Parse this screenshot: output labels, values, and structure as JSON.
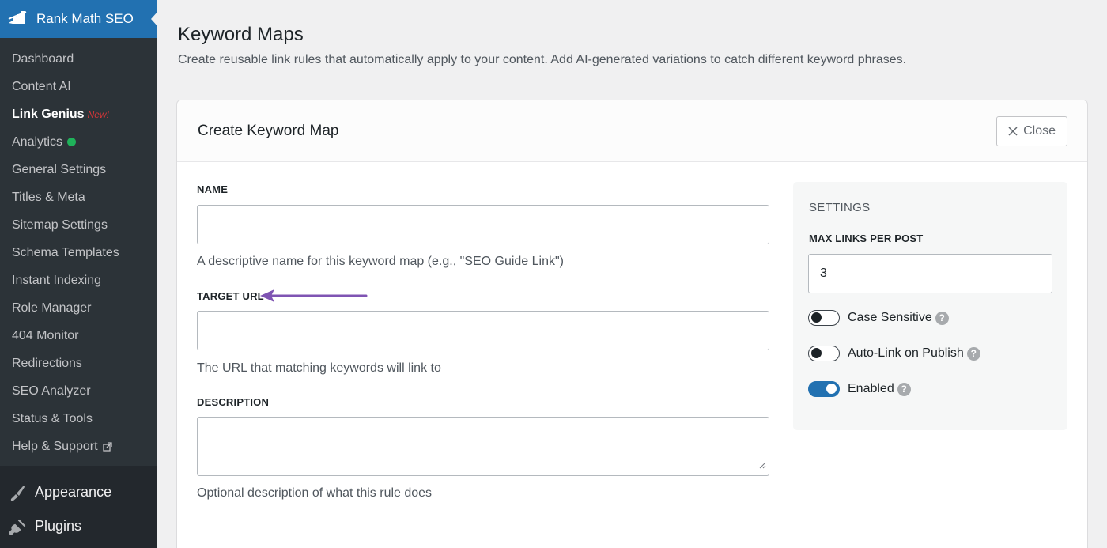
{
  "sidebar": {
    "brand": "Rank Math SEO",
    "items": [
      {
        "label": "Dashboard"
      },
      {
        "label": "Content AI"
      },
      {
        "label": "Link Genius",
        "badge": "New!"
      },
      {
        "label": "Analytics"
      },
      {
        "label": "General Settings"
      },
      {
        "label": "Titles & Meta"
      },
      {
        "label": "Sitemap Settings"
      },
      {
        "label": "Schema Templates"
      },
      {
        "label": "Instant Indexing"
      },
      {
        "label": "Role Manager"
      },
      {
        "label": "404 Monitor"
      },
      {
        "label": "Redirections"
      },
      {
        "label": "SEO Analyzer"
      },
      {
        "label": "Status & Tools"
      },
      {
        "label": "Help & Support"
      }
    ],
    "main": [
      {
        "label": "Appearance",
        "icon": "paintbrush-icon"
      },
      {
        "label": "Plugins",
        "icon": "plugin-icon"
      }
    ]
  },
  "page": {
    "title": "Keyword Maps",
    "description": "Create reusable link rules that automatically apply to your content. Add AI-generated variations to catch different keyword phrases."
  },
  "card": {
    "title": "Create Keyword Map",
    "close_label": "Close"
  },
  "form": {
    "name_label": "NAME",
    "name_value": "",
    "name_help": "A descriptive name for this keyword map (e.g., \"SEO Guide Link\")",
    "url_label": "TARGET URL",
    "url_value": "",
    "url_help": "The URL that matching keywords will link to",
    "desc_label": "DESCRIPTION",
    "desc_value": "",
    "desc_help": "Optional description of what this rule does"
  },
  "settings": {
    "title": "SETTINGS",
    "max_links_label": "MAX LINKS PER POST",
    "max_links_value": "3",
    "toggles": [
      {
        "label": "Case Sensitive",
        "on": false
      },
      {
        "label": "Auto-Link on Publish",
        "on": false
      },
      {
        "label": "Enabled",
        "on": true
      }
    ]
  },
  "colors": {
    "accent": "#2271b1",
    "sidebar_bg": "#23282d",
    "submenu_bg": "#2c3338",
    "new_badge": "#d63638",
    "status_dot": "#1fb25a",
    "annotation_arrow": "#7f54b3"
  }
}
